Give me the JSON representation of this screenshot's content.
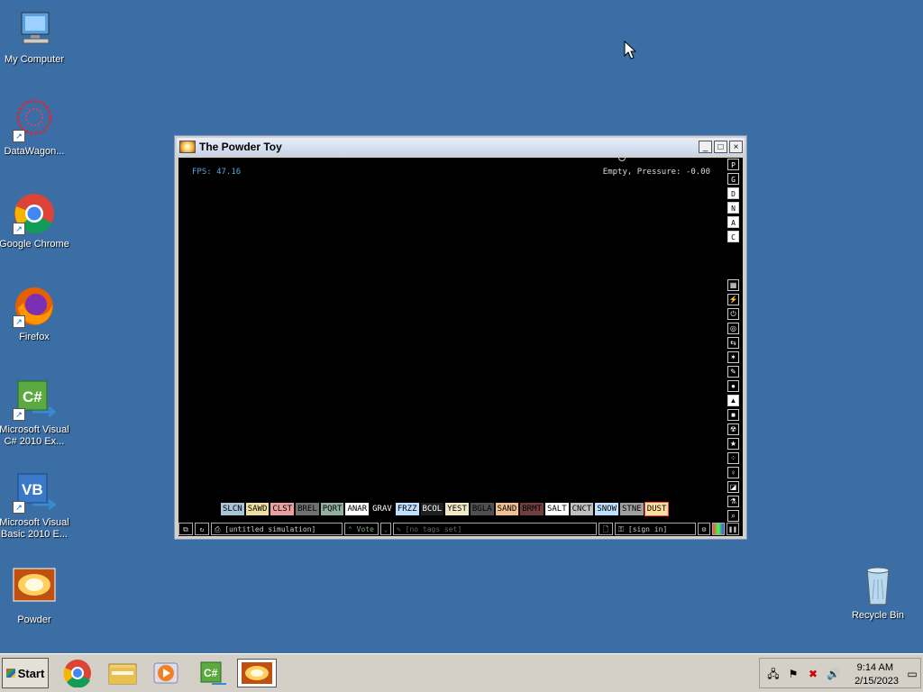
{
  "desktop": {
    "icons": [
      {
        "label": "My Computer",
        "icon": "computer-icon"
      },
      {
        "label": "DataWagon...",
        "icon": "datawagon-icon"
      },
      {
        "label": "Google Chrome",
        "icon": "chrome-icon"
      },
      {
        "label": "Firefox",
        "icon": "firefox-icon"
      },
      {
        "label": "Microsoft Visual C# 2010 Ex...",
        "icon": "visual-csharp-icon"
      },
      {
        "label": "Microsoft Visual Basic 2010 E...",
        "icon": "visual-basic-icon"
      },
      {
        "label": "Powder",
        "icon": "powder-icon"
      },
      {
        "label": "Recycle Bin",
        "icon": "recycle-bin-icon"
      }
    ]
  },
  "window": {
    "title": "The Powder Toy",
    "min": "_",
    "max": "□",
    "close": "×",
    "fps": "FPS: 47.16",
    "status": "Empty, Pressure: -0.00",
    "side_buttons": [
      "P",
      "G",
      "D",
      "N",
      "A",
      "C"
    ],
    "elements": [
      {
        "label": "SLCN",
        "bg": "#a8c4d8"
      },
      {
        "label": "SAWD",
        "bg": "#f0e0a0"
      },
      {
        "label": "CLST",
        "bg": "#e8a0a0"
      },
      {
        "label": "BREL",
        "bg": "#707070"
      },
      {
        "label": "PQRT",
        "bg": "#90b0a0"
      },
      {
        "label": "ANAR",
        "bg": "#ffffff"
      },
      {
        "label": "GRAV",
        "bg": "#000000",
        "fg": "#ffffff"
      },
      {
        "label": "FRZZ",
        "bg": "#c0e0ff"
      },
      {
        "label": "BCOL",
        "bg": "#202020",
        "fg": "#ffffff"
      },
      {
        "label": "YEST",
        "bg": "#f0e8c8"
      },
      {
        "label": "BGLA",
        "bg": "#505050"
      },
      {
        "label": "SAND",
        "bg": "#f0c090"
      },
      {
        "label": "BRMT",
        "bg": "#704040"
      },
      {
        "label": "SALT",
        "bg": "#ffffff"
      },
      {
        "label": "CNCT",
        "bg": "#c0c0c0"
      },
      {
        "label": "SNOW",
        "bg": "#c0e0ff"
      },
      {
        "label": "STNE",
        "bg": "#a0a0a0"
      },
      {
        "label": "DUST",
        "bg": "#ffe0a0"
      }
    ],
    "bottom": {
      "sim_name": "[untitled simulation]",
      "vote": "Vote",
      "tags": "[no tags set]",
      "signin": "[sign in]"
    }
  },
  "taskbar": {
    "start": "Start",
    "items": [
      "chrome-icon",
      "explorer-icon",
      "media-player-icon",
      "visual-csharp-icon",
      "powder-icon"
    ],
    "time": "9:14 AM",
    "date": "2/15/2023"
  }
}
